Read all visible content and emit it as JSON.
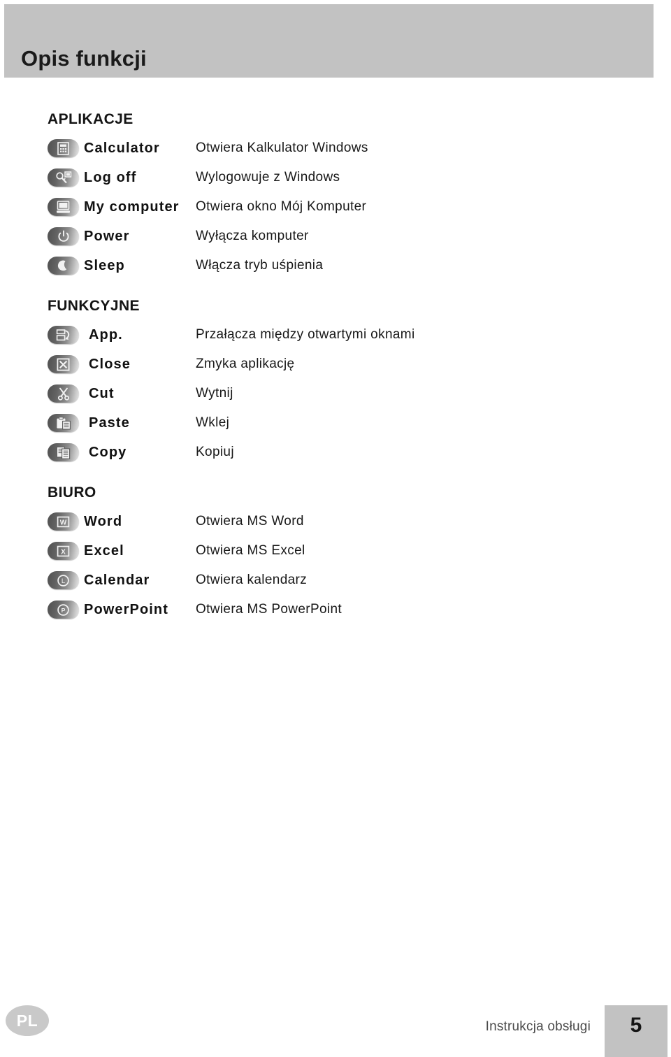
{
  "header": {
    "title": "Opis funkcji",
    "background_color": "#c2c2c2"
  },
  "sections": [
    {
      "heading": "APLIKACJE",
      "rows": [
        {
          "icon": "calculator-icon",
          "label": "Calculator",
          "description": "Otwiera Kalkulator Windows"
        },
        {
          "icon": "key-logoff-icon",
          "label": "Log off",
          "description": "Wylogowuje z Windows"
        },
        {
          "icon": "my-computer-icon",
          "label": "My computer",
          "description": "Otwiera okno Mój Komputer"
        },
        {
          "icon": "power-icon",
          "label": "Power",
          "description": "Wyłącza komputer"
        },
        {
          "icon": "moon-sleep-icon",
          "label": "Sleep",
          "description": "Włącza tryb uśpienia"
        }
      ]
    },
    {
      "heading": "FUNKCYJNE",
      "rows": [
        {
          "icon": "switch-app-icon",
          "label": "App.",
          "description": "Przałącza między otwartymi oknami"
        },
        {
          "icon": "close-x-icon",
          "label": "Close",
          "description": "Zmyka aplikację"
        },
        {
          "icon": "scissors-icon",
          "label": "Cut",
          "description": "Wytnij"
        },
        {
          "icon": "clipboard-paste-icon",
          "label": "Paste",
          "description": "Wklej"
        },
        {
          "icon": "copy-pages-icon",
          "label": "Copy",
          "description": "Kopiuj"
        }
      ]
    },
    {
      "heading": "BIURO",
      "rows": [
        {
          "icon": "word-w-icon",
          "label": "Word",
          "description": "Otwiera MS Word"
        },
        {
          "icon": "excel-x-icon",
          "label": "Excel",
          "description": "Otwiera MS Excel"
        },
        {
          "icon": "calendar-l-icon",
          "label": "Calendar",
          "description": "Otwiera kalendarz"
        },
        {
          "icon": "powerpoint-p-icon",
          "label": "PowerPoint",
          "description": "Otwiera MS PowerPoint"
        }
      ]
    }
  ],
  "footer": {
    "language_badge": "PL",
    "note": "Instrukcja obsługi",
    "page_number": "5"
  }
}
